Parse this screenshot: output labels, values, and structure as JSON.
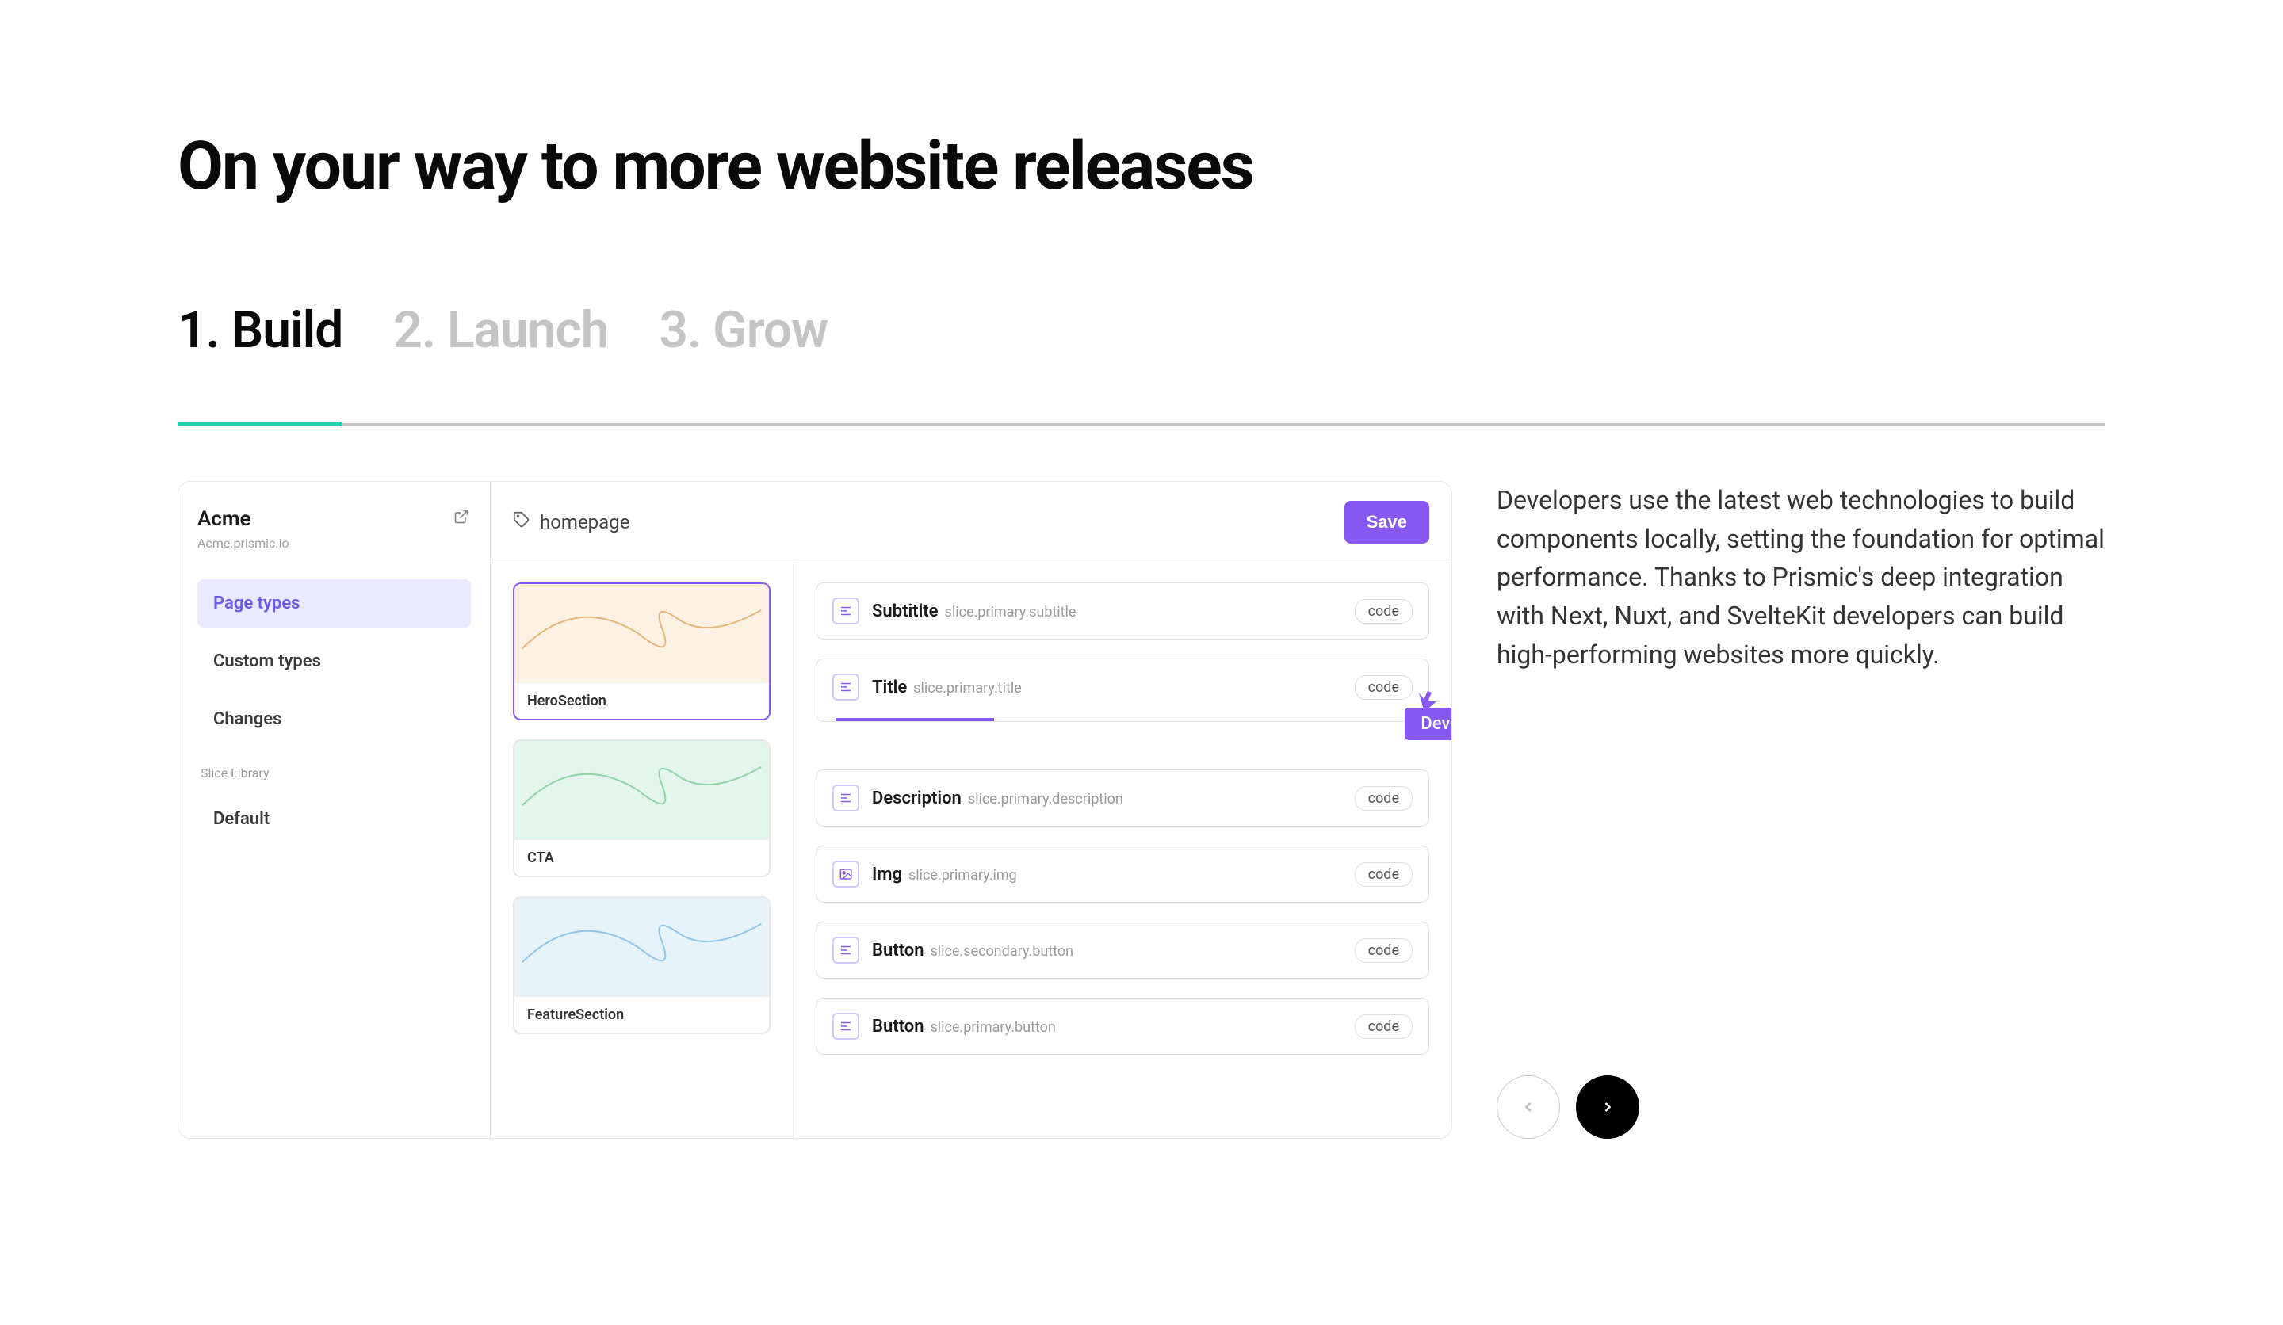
{
  "page": {
    "title": "On your way to more website releases"
  },
  "tabs": [
    {
      "label": "1. Build",
      "active": true
    },
    {
      "label": "2. Launch",
      "active": false
    },
    {
      "label": "3. Grow",
      "active": false
    }
  ],
  "app": {
    "sidebar": {
      "name": "Acme",
      "domain": "Acme.prismic.io",
      "nav": [
        {
          "label": "Page types",
          "active": true
        },
        {
          "label": "Custom types",
          "active": false
        },
        {
          "label": "Changes",
          "active": false
        }
      ],
      "section_label": "Slice Library",
      "library_items": [
        {
          "label": "Default"
        }
      ]
    },
    "header": {
      "breadcrumb": "homepage",
      "save": "Save"
    },
    "slices": [
      {
        "label": "HeroSection",
        "tone": "orange",
        "selected": true
      },
      {
        "label": "CTA",
        "tone": "green",
        "selected": false
      },
      {
        "label": "FeatureSection",
        "tone": "blue",
        "selected": false
      }
    ],
    "fields": [
      {
        "name": "Subtitlte",
        "path": "slice.primary.subtitle",
        "badge": "code",
        "kind": "text"
      },
      {
        "name": "Title",
        "path": "slice.primary.title",
        "badge": "code",
        "kind": "text",
        "editing": true
      },
      {
        "name": "Description",
        "path": "slice.primary.description",
        "badge": "code",
        "kind": "text"
      },
      {
        "name": "Img",
        "path": "slice.primary.img",
        "badge": "code",
        "kind": "image"
      },
      {
        "name": "Button",
        "path": "slice.secondary.button",
        "badge": "code",
        "kind": "text"
      },
      {
        "name": "Button",
        "path": "slice.primary.button",
        "badge": "code",
        "kind": "text"
      }
    ],
    "cursor_label": "Developer"
  },
  "description": "Developers use the latest web technologies to build components locally, setting the foundation for optimal performance. Thanks to Prismic's deep integration with Next, Nuxt, and SvelteKit developers can build high-performing websites more quickly.",
  "colors": {
    "accent": "#8759f2",
    "teal": "#1dd3b0"
  }
}
